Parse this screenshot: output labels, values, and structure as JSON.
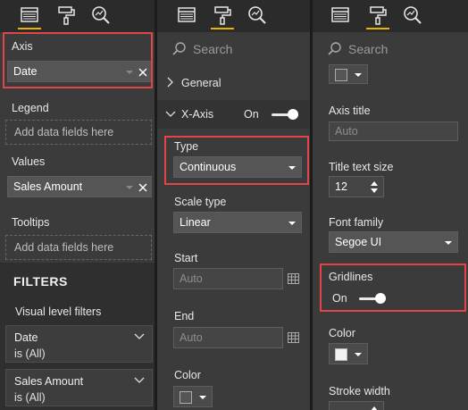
{
  "colors": {
    "panel_bg": "#3b3b3b",
    "iconbar_bg": "#2b2b2b",
    "accent": "#e8b400",
    "highlight": "#e24545",
    "field_bg": "#555555"
  },
  "icons": {
    "fields_tab": "fields-grid-icon",
    "format_tab": "paint-roller-icon",
    "analytics_tab": "analytics-magnifier-icon",
    "search": "search-icon"
  },
  "fields_pane": {
    "axis": {
      "label": "Axis",
      "value": "Date"
    },
    "legend": {
      "label": "Legend",
      "placeholder": "Add data fields here"
    },
    "values": {
      "label": "Values",
      "value": "Sales Amount"
    },
    "tooltips": {
      "label": "Tooltips",
      "placeholder": "Add data fields here"
    },
    "filters": {
      "title": "FILTERS",
      "visual_level_label": "Visual level filters",
      "items": [
        {
          "name": "Date",
          "state": "is (All)"
        },
        {
          "name": "Sales Amount",
          "state": "is (All)"
        }
      ]
    }
  },
  "format_pane": {
    "search_placeholder": "Search",
    "general": "General",
    "xaxis": {
      "label": "X-Axis",
      "toggle_state": "On"
    },
    "type": {
      "label": "Type",
      "value": "Continuous"
    },
    "scale_type": {
      "label": "Scale type",
      "value": "Linear"
    },
    "start": {
      "label": "Start",
      "placeholder": "Auto"
    },
    "end": {
      "label": "End",
      "placeholder": "Auto"
    },
    "color": {
      "label": "Color"
    }
  },
  "format_pane_2": {
    "search_placeholder": "Search",
    "axis_title": {
      "label": "Axis title",
      "placeholder": "Auto"
    },
    "title_text_size": {
      "label": "Title text size",
      "value": "12"
    },
    "font_family": {
      "label": "Font family",
      "value": "Segoe UI"
    },
    "gridlines": {
      "label": "Gridlines",
      "toggle_state": "On"
    },
    "color": {
      "label": "Color"
    },
    "stroke_width": {
      "label": "Stroke width"
    }
  }
}
